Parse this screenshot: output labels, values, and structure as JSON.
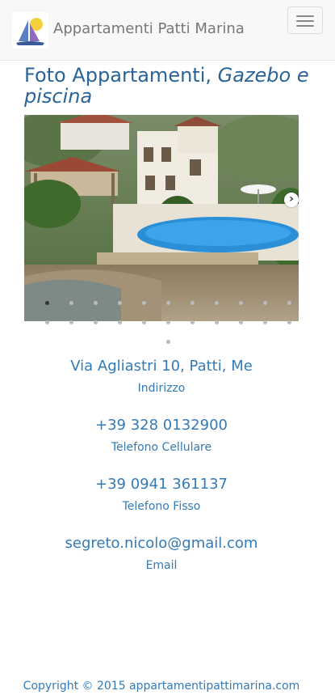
{
  "navbar": {
    "brand": "Appartamenti Patti Marina",
    "logo_icon": "sailboat-sun-logo",
    "toggle_icon": "hamburger-menu-icon"
  },
  "gallery": {
    "title_main": "Foto Appartamenti,",
    "title_italic": "Gazebo e piscina",
    "next_icon": "chevron-right-icon",
    "indicator_count": 24,
    "active_index": 0
  },
  "contacts": [
    {
      "value": "Via Agliastri 10, Patti, Me",
      "label": "Indirizzo"
    },
    {
      "value": "+39 328 0132900",
      "label": "Telefono Cellulare"
    },
    {
      "value": "+39 0941 361137",
      "label": "Telefono Fisso"
    },
    {
      "value": "segreto.nicolo@gmail.com",
      "label": "Email"
    }
  ],
  "footer": {
    "copyright": "Copyright © 2015 appartamentipattimarina.com"
  },
  "colors": {
    "link": "#337ab7",
    "heading": "#2a6496",
    "brand_text": "#777777",
    "navbar_bg": "#f8f8f8"
  }
}
